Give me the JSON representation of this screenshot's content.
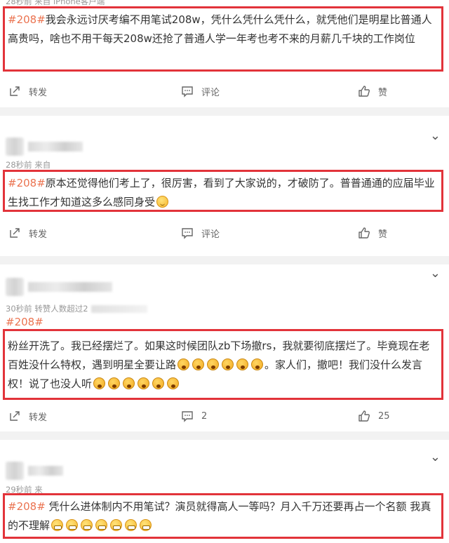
{
  "posts": [
    {
      "meta_partial": "28秒前 来自 iPhone客户端",
      "tag": "#208#",
      "text": "我会永远讨厌考编不用笔试208w，凭什么凭什么凭什么，就凭他们是明星比普通人高贵吗，啥也不用干每天208w还抢了普通人学一年考也考不来的月薪几千块的工作岗位",
      "forward_label": "转发",
      "comment_label": "评论",
      "like_label": "赞"
    },
    {
      "meta": "28秒前 来自",
      "tag": "#208#",
      "text": "原本还觉得他们考上了，很厉害，看到了大家说的，才破防了。普普通通的应届毕业生找工作才知道这多么感同身受",
      "emoji": "smile",
      "forward_label": "转发",
      "comment_label": "评论",
      "like_label": "赞"
    },
    {
      "meta": "30秒前 转赞人数超过2",
      "tag": "#208#",
      "text_a": "粉丝开洗了。我已经摆烂了。如果这时候团队zb下场撤rs，我就要彻底摆烂了。毕竟现在老百姓没什么特权，遇到明星全要让路",
      "text_b": "。家人们，撤吧！我们没什么发言权！说了也没人听",
      "emoji": "cry",
      "forward_label": "转发",
      "comment_count": "2",
      "like_count": "25"
    },
    {
      "meta": "29秒前 来",
      "tag": "#208#",
      "text": " 凭什么进体制内不用笔试？演员就得高人一等吗？月入千万还要再占一个名额 我真的不理解",
      "emoji": "grin"
    }
  ],
  "icons": {
    "forward": "forward-icon",
    "comment": "comment-icon",
    "like": "thumbs-up-icon",
    "more": "chevron-down-icon",
    "smile": "smile-emoji",
    "cry": "crying-emoji",
    "grin": "grin-emoji"
  },
  "colors": {
    "highlight_border": "#e2333a",
    "tag": "#eb7350",
    "separator": "#f2f2f2"
  }
}
